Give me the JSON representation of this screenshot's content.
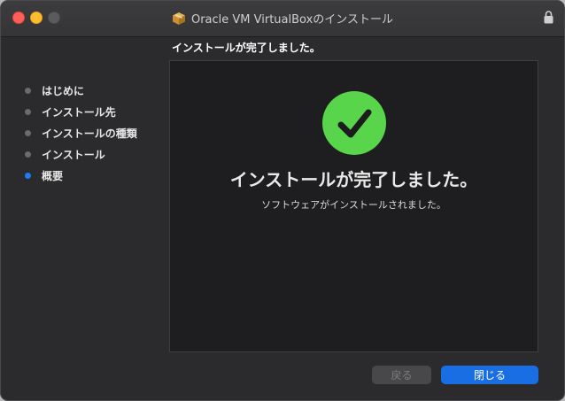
{
  "window": {
    "title": "Oracle VM VirtualBoxのインストール",
    "title_icon": "package-icon",
    "lock_icon": "lock-icon"
  },
  "header": {
    "subtitle": "インストールが完了しました。"
  },
  "sidebar": {
    "steps": [
      {
        "label": "はじめに",
        "active": false
      },
      {
        "label": "インストール先",
        "active": false
      },
      {
        "label": "インストールの種類",
        "active": false
      },
      {
        "label": "インストール",
        "active": false
      },
      {
        "label": "概要",
        "active": true
      }
    ]
  },
  "main": {
    "status_icon": "checkmark-icon",
    "heading": "インストールが完了しました。",
    "description": "ソフトウェアがインストールされました。"
  },
  "buttons": {
    "back_label": "戻る",
    "close_label": "閉じる"
  },
  "colors": {
    "accent": "#1a6ee4",
    "success": "#59d54b",
    "active_step": "#1b7cf4"
  }
}
